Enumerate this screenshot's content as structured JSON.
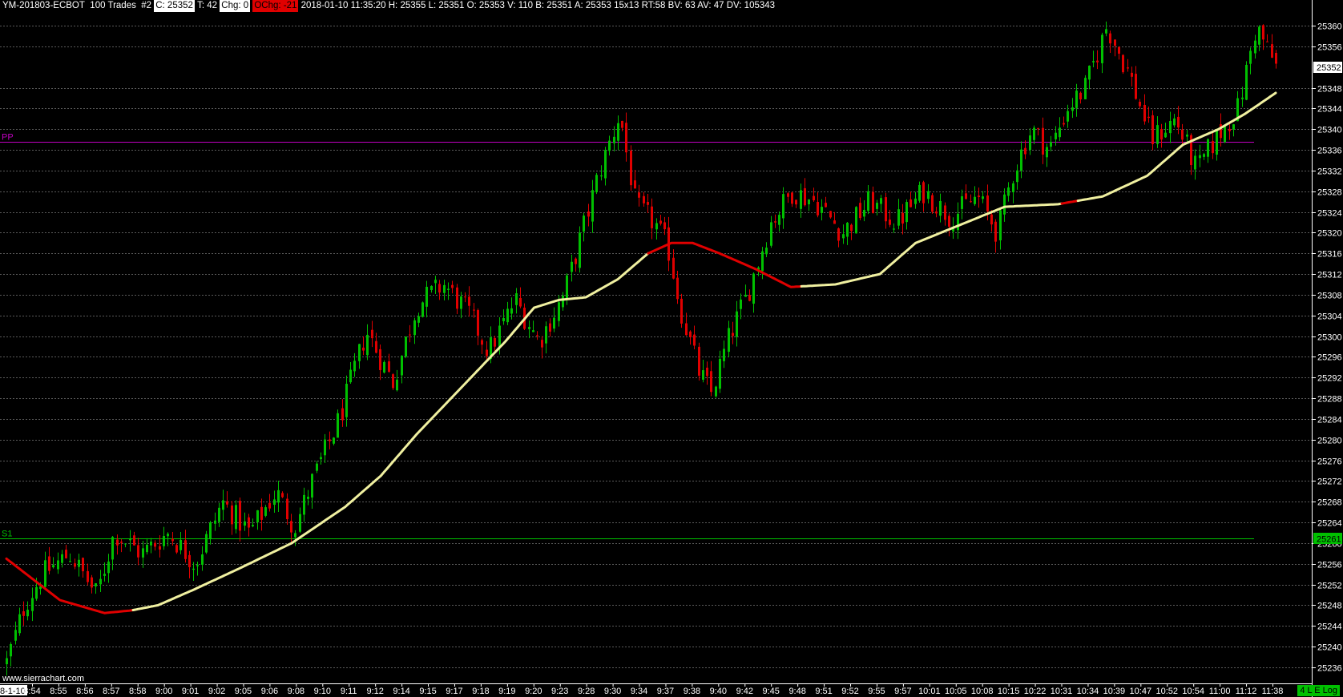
{
  "header": {
    "symbol": "YM-201803-ECBOT",
    "bar_type": "100 Trades",
    "chart_num": "#2",
    "close": "C: 25352",
    "ticks": "T: 42",
    "chg": "Chg: 0",
    "ochg": "OChg: -21",
    "details": "2018-01-10 11:35:20 H: 25355 L: 25351 O: 25353 V: 110 B: 25351 A: 25353 15x13 RT:58 BV: 63 AV: 47 DV: 105343"
  },
  "watermark": "www.sierrachart.com",
  "badge": "4 L E Log",
  "colors": {
    "background": "#000000",
    "up": "#00c000",
    "down": "#e00000",
    "ma_up": "#f0f0a0",
    "ma_down": "#e00000",
    "pp": "#c000c0",
    "s1": "#00c000",
    "grid": "#5a5a5a"
  },
  "chart_data": {
    "type": "candlestick",
    "ylim": [
      25234,
      25364
    ],
    "y_ticks": [
      25236,
      25240,
      25244,
      25248,
      25252,
      25256,
      25260,
      25264,
      25268,
      25272,
      25276,
      25280,
      25284,
      25288,
      25292,
      25296,
      25300,
      25304,
      25308,
      25312,
      25316,
      25320,
      25324,
      25328,
      25332,
      25336,
      25340,
      25344,
      25348,
      25356,
      25360
    ],
    "x_labels": [
      "8-1-10",
      "8:54",
      "8:55",
      "8:56",
      "8:57",
      "8:58",
      "9:00",
      "9:01",
      "9:02",
      "9:05",
      "9:06",
      "9:08",
      "9:10",
      "9:11",
      "9:12",
      "9:14",
      "9:15",
      "9:17",
      "9:18",
      "9:19",
      "9:20",
      "9:23",
      "9:28",
      "9:30",
      "9:34",
      "9:37",
      "9:38",
      "9:40",
      "9:42",
      "9:45",
      "9:48",
      "9:51",
      "9:52",
      "9:55",
      "9:57",
      "10:01",
      "10:05",
      "10:08",
      "10:15",
      "10:22",
      "10:31",
      "10:34",
      "10:39",
      "10:47",
      "10:52",
      "10:54",
      "11:00",
      "11:12",
      "11:38"
    ],
    "last_price": "25352",
    "levels": [
      {
        "name": "PP",
        "value": 25337.5,
        "label": "PP"
      },
      {
        "name": "S1",
        "value": 25261,
        "label": "S1",
        "price_label": "25261"
      }
    ],
    "bar_count": 300,
    "price_path": [
      [
        0,
        25237
      ],
      [
        10,
        25248
      ],
      [
        20,
        25254
      ],
      [
        35,
        25258
      ],
      [
        50,
        25250
      ],
      [
        60,
        25262
      ],
      [
        75,
        25258
      ],
      [
        90,
        25262
      ],
      [
        105,
        25256
      ],
      [
        120,
        25268
      ],
      [
        135,
        25262
      ],
      [
        150,
        25270
      ],
      [
        160,
        25263
      ],
      [
        170,
        25272
      ],
      [
        185,
        25284
      ],
      [
        200,
        25301
      ],
      [
        215,
        25291
      ],
      [
        228,
        25306
      ],
      [
        243,
        25310
      ],
      [
        258,
        25304
      ],
      [
        268,
        25297
      ],
      [
        283,
        25307
      ],
      [
        296,
        25299
      ],
      [
        310,
        25308
      ],
      [
        320,
        25320
      ],
      [
        330,
        25332
      ],
      [
        341,
        25343
      ],
      [
        350,
        25325
      ],
      [
        360,
        25322
      ],
      [
        368,
        25317
      ],
      [
        375,
        25305
      ],
      [
        385,
        25293
      ],
      [
        392,
        25289
      ],
      [
        402,
        25300
      ],
      [
        412,
        25308
      ],
      [
        425,
        25322
      ],
      [
        437,
        25328
      ],
      [
        450,
        25326
      ],
      [
        465,
        25320
      ],
      [
        480,
        25326
      ],
      [
        495,
        25322
      ],
      [
        510,
        25328
      ],
      [
        525,
        25323
      ],
      [
        540,
        25327
      ],
      [
        551,
        25320
      ],
      [
        560,
        25332
      ],
      [
        570,
        25340
      ],
      [
        580,
        25336
      ],
      [
        590,
        25344
      ],
      [
        600,
        25348
      ],
      [
        612,
        25360
      ],
      [
        625,
        25350
      ],
      [
        637,
        25338
      ],
      [
        650,
        25342
      ],
      [
        662,
        25332
      ],
      [
        672,
        25338
      ],
      [
        685,
        25344
      ],
      [
        695,
        25360
      ],
      [
        706,
        25352
      ]
    ],
    "ma_path": [
      [
        0,
        25257
      ],
      [
        30,
        25249
      ],
      [
        55,
        25246.5
      ],
      [
        70,
        25247
      ],
      [
        85,
        25248
      ],
      [
        105,
        25251
      ],
      [
        130,
        25255
      ],
      [
        160,
        25260
      ],
      [
        190,
        25267
      ],
      [
        210,
        25273
      ],
      [
        230,
        25281
      ],
      [
        255,
        25290
      ],
      [
        280,
        25299
      ],
      [
        296,
        25305.5
      ],
      [
        310,
        25307
      ],
      [
        325,
        25307.5
      ],
      [
        343,
        25311
      ],
      [
        360,
        25316
      ],
      [
        373,
        25318
      ],
      [
        385,
        25318
      ],
      [
        400,
        25316
      ],
      [
        420,
        25313
      ],
      [
        440,
        25309.5
      ],
      [
        465,
        25310
      ],
      [
        490,
        25312
      ],
      [
        510,
        25318
      ],
      [
        535,
        25321.5
      ],
      [
        560,
        25325
      ],
      [
        590,
        25325.5
      ],
      [
        615,
        25327
      ],
      [
        640,
        25331
      ],
      [
        660,
        25337
      ],
      [
        680,
        25340
      ],
      [
        695,
        25343
      ],
      [
        712,
        25347
      ]
    ],
    "ma_red_segments": [
      [
        0,
        70
      ],
      [
        360,
        445
      ],
      [
        592,
        600
      ]
    ]
  }
}
